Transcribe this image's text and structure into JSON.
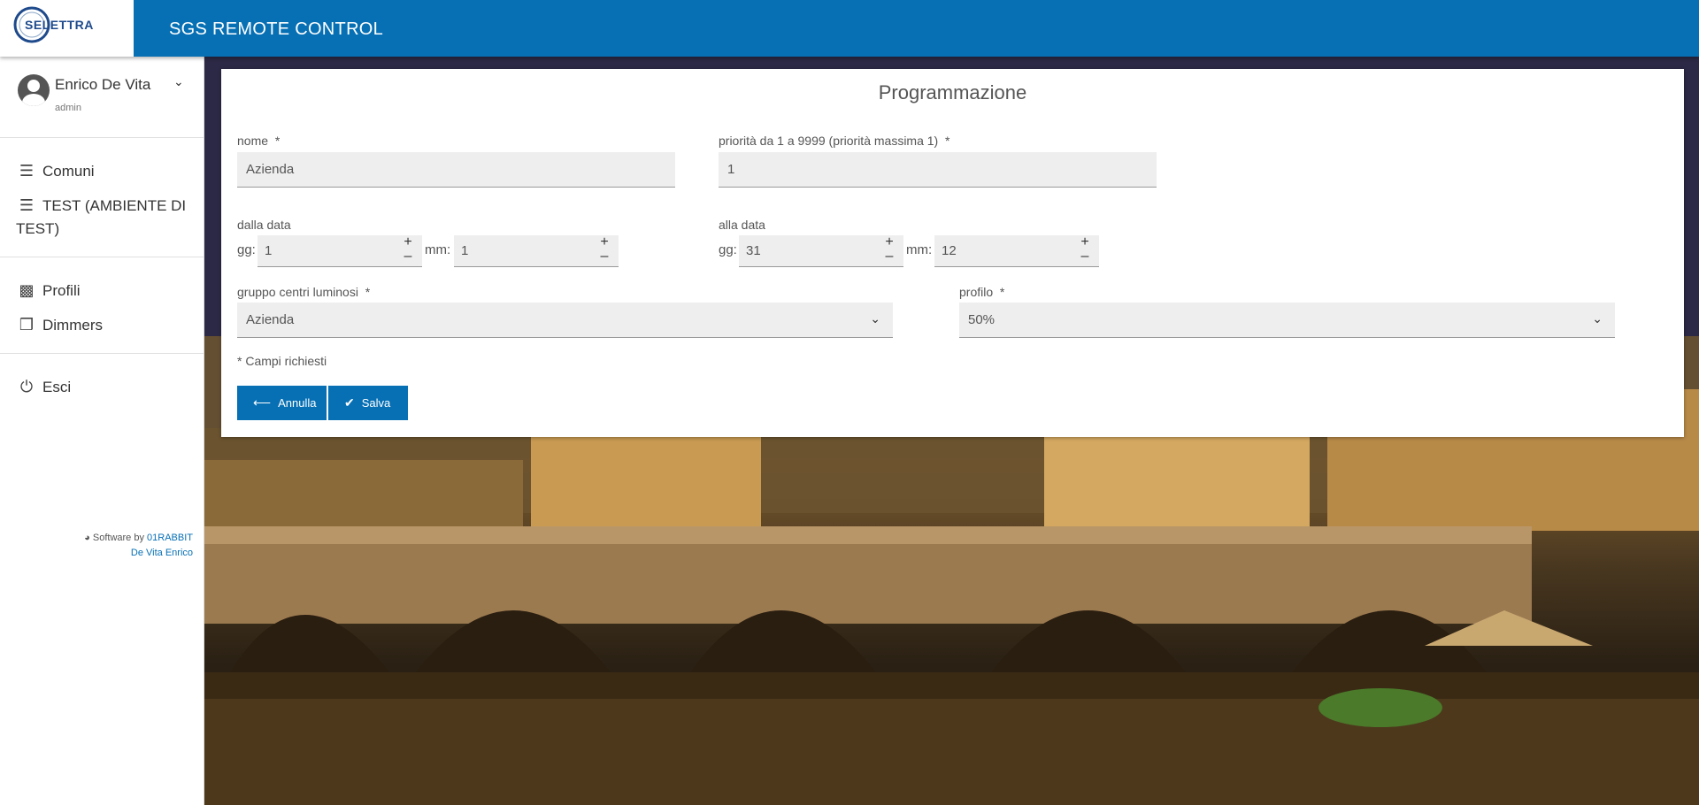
{
  "app": {
    "logo_text": "SELETTRA",
    "title": "SGS REMOTE CONTROL"
  },
  "sidebar": {
    "user": {
      "name": "Enrico De Vita",
      "role": "admin",
      "icon": "account-circle-icon",
      "expand_icon": "chevron-down-icon"
    },
    "groups": [
      [
        {
          "label": "Comuni",
          "icon": "signpost-icon"
        },
        {
          "label": "TEST (AMBIENTE DI TEST)",
          "icon": "signpost-icon"
        }
      ],
      [
        {
          "label": "Profili",
          "icon": "bar-chart-icon"
        },
        {
          "label": "Dimmers",
          "icon": "cubes-icon"
        }
      ],
      [
        {
          "label": "Esci",
          "icon": "power-icon"
        }
      ]
    ],
    "credit": {
      "prefix": "Software by",
      "company": "01RABBIT",
      "author": "De Vita Enrico"
    }
  },
  "form": {
    "title": "Programmazione",
    "nome": {
      "label": "nome",
      "required_mark": "*",
      "value": "Azienda"
    },
    "priorita": {
      "label": "priorità da 1 a 9999 (priorità massima 1)",
      "required_mark": "*",
      "value": "1"
    },
    "dalla_data": {
      "label": "dalla data",
      "gg_label": "gg:",
      "gg_value": "1",
      "mm_label": "mm:",
      "mm_value": "1"
    },
    "alla_data": {
      "label": "alla data",
      "gg_label": "gg:",
      "gg_value": "31",
      "mm_label": "mm:",
      "mm_value": "12"
    },
    "gruppo": {
      "label": "gruppo centri luminosi",
      "required_mark": "*",
      "value": "Azienda"
    },
    "profilo": {
      "label": "profilo",
      "required_mark": "*",
      "value": "50%"
    },
    "required_note": "* Campi richiesti",
    "buttons": {
      "cancel": "Annulla",
      "save": "Salva"
    }
  },
  "colors": {
    "primary": "#0770b5",
    "field_bg": "#eeeeee"
  }
}
